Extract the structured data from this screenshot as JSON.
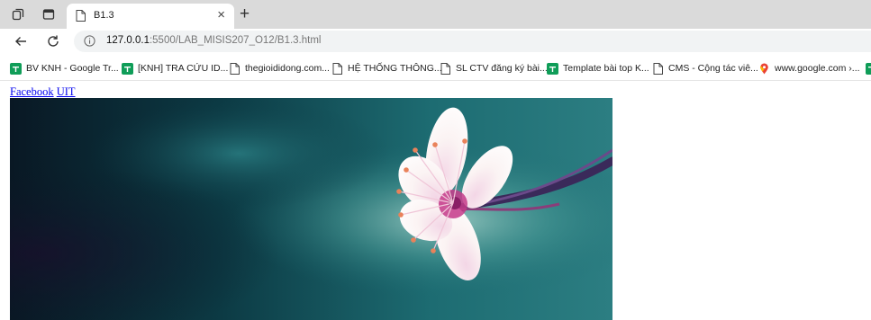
{
  "browser": {
    "tab": {
      "title": "B1.3",
      "close_glyph": "×"
    },
    "new_tab_glyph": "+",
    "address": {
      "host": "127.0.0.1",
      "path": ":5500/LAB_MISIS207_O12/B1.3.html"
    },
    "bookmarks": [
      {
        "label": "BV KNH - Google Tr...",
        "icon": "sheets-icon"
      },
      {
        "label": "[KNH] TRA CỨU ID...",
        "icon": "sheets-icon"
      },
      {
        "label": "thegioididong.com...",
        "icon": "page-icon"
      },
      {
        "label": "HỆ THỐNG THÔNG...",
        "icon": "page-icon"
      },
      {
        "label": "SL CTV đăng ký bài...",
        "icon": "page-icon"
      },
      {
        "label": "Template bài top K...",
        "icon": "sheets-icon"
      },
      {
        "label": "CMS - Cộng tác viê...",
        "icon": "page-icon"
      },
      {
        "label": "www.google.com ›...",
        "icon": "maps-pin-icon"
      }
    ]
  },
  "page": {
    "links": [
      {
        "label": "Facebook"
      },
      {
        "label": "UIT"
      }
    ]
  },
  "colors": {
    "tabstrip": "#dadada",
    "address_bar": "#f1f3f4",
    "sheets_green": "#0f9d58",
    "link_blue": "#0000ee"
  }
}
